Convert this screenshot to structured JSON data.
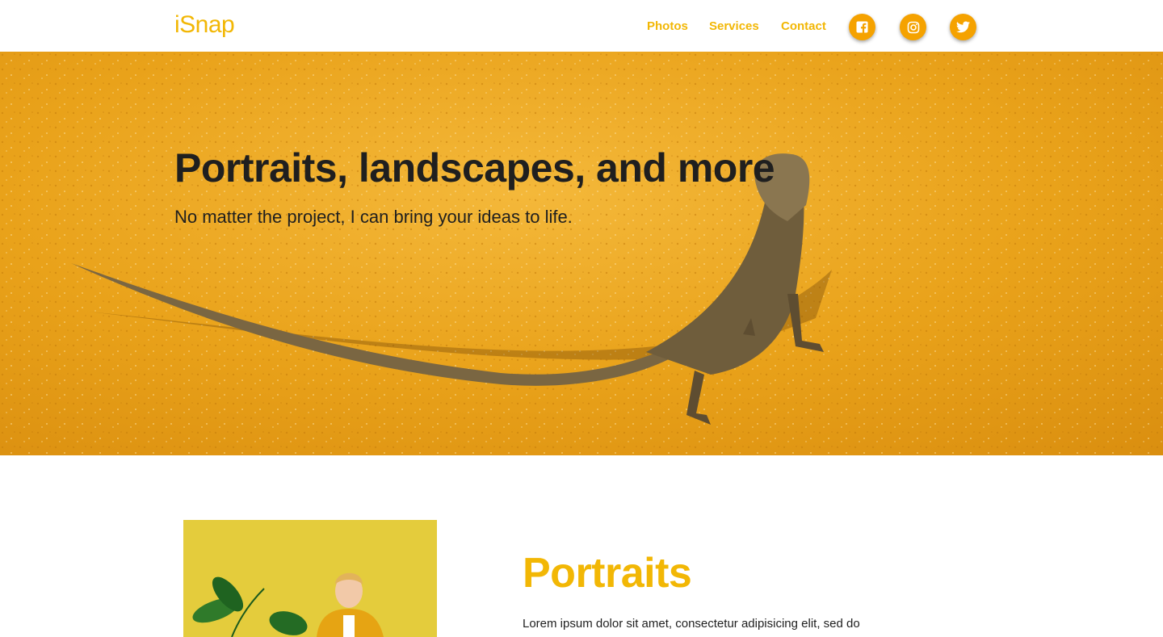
{
  "header": {
    "logo": "iSnap",
    "nav": [
      {
        "label": "Photos"
      },
      {
        "label": "Services"
      },
      {
        "label": "Contact"
      }
    ],
    "social": [
      {
        "icon": "facebook-icon"
      },
      {
        "icon": "instagram-icon"
      },
      {
        "icon": "twitter-icon"
      }
    ]
  },
  "hero": {
    "title": "Portraits, landscapes, and more",
    "subtitle": "No matter the project, I can bring your ideas to life.",
    "image": "lizard-on-sand"
  },
  "portraits": {
    "title": "Portraits",
    "text": "Lorem ipsum dolor sit amet, consectetur adipisicing elit, sed do",
    "image": "child-with-plant"
  },
  "colors": {
    "accent": "#f2b705",
    "social_bg": "#f5a200",
    "hero_bg": "#e9a21a",
    "text": "#1f1f1f"
  }
}
